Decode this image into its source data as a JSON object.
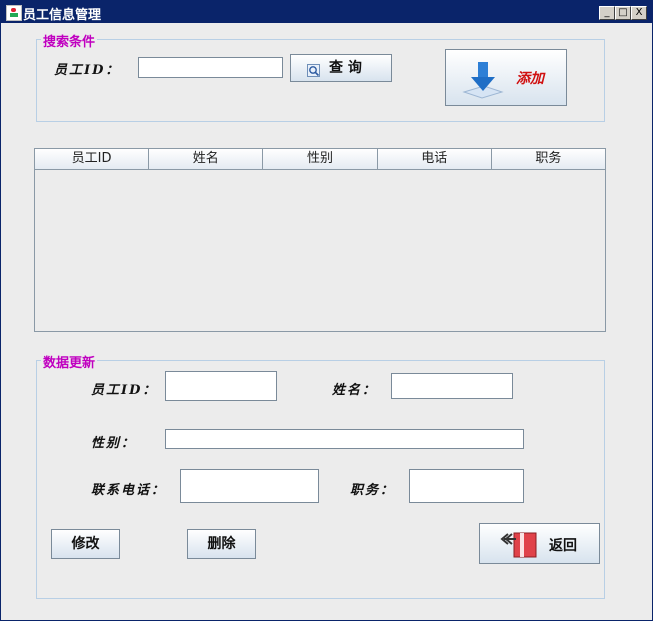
{
  "window": {
    "title": "员工信息管理",
    "minimize": "_",
    "maximize": "□",
    "close": "X"
  },
  "search_group": {
    "title": "搜索条件",
    "employee_id_label": "员工ID：",
    "employee_id_value": "",
    "query_label": "查  询",
    "add_label": "添加"
  },
  "table": {
    "columns": [
      "员工ID",
      "姓名",
      "性别",
      "电话",
      "职务"
    ],
    "rows": []
  },
  "update_group": {
    "title": "数据更新",
    "employee_id_label": "员工ID：",
    "name_label": "姓名：",
    "gender_label": "性别：",
    "phone_label": "联系电话：",
    "position_label": "职务：",
    "employee_id_value": "",
    "name_value": "",
    "gender_value": "",
    "phone_value": "",
    "position_value": "",
    "modify_label": "修改",
    "delete_label": "删除",
    "back_label": "返回"
  },
  "colors": {
    "titlebar": "#0a246a",
    "group_title": "#c000c0",
    "add_text": "#d01010",
    "panel_bg": "#ececec"
  },
  "icons": {
    "query": "magnifier-icon",
    "add": "download-arrow-icon",
    "back": "return-arrow-icon"
  }
}
